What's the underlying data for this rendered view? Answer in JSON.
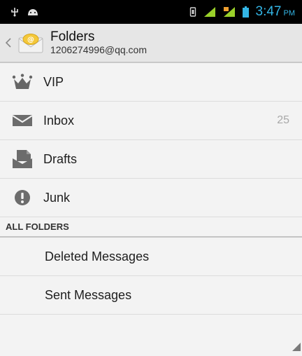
{
  "status_bar": {
    "left_icons": [
      "usb-icon",
      "android-debug-icon"
    ],
    "right_icons": [
      "vibrate-icon",
      "signal-icon",
      "data-signal-icon",
      "battery-icon"
    ],
    "time": "3:47",
    "ampm": "PM",
    "clock_color": "#33b5e5"
  },
  "action_bar": {
    "title": "Folders",
    "account": "1206274996@qq.com",
    "icon": "email-app-icon"
  },
  "folders": [
    {
      "label": "VIP",
      "icon": "crown-icon",
      "count": ""
    },
    {
      "label": "Inbox",
      "icon": "envelope-icon",
      "count": "25"
    },
    {
      "label": "Drafts",
      "icon": "drafts-icon",
      "count": ""
    },
    {
      "label": "Junk",
      "icon": "alert-icon",
      "count": ""
    }
  ],
  "section_header": "ALL FOLDERS",
  "all_folders": [
    {
      "label": "Deleted Messages"
    },
    {
      "label": "Sent Messages"
    }
  ]
}
